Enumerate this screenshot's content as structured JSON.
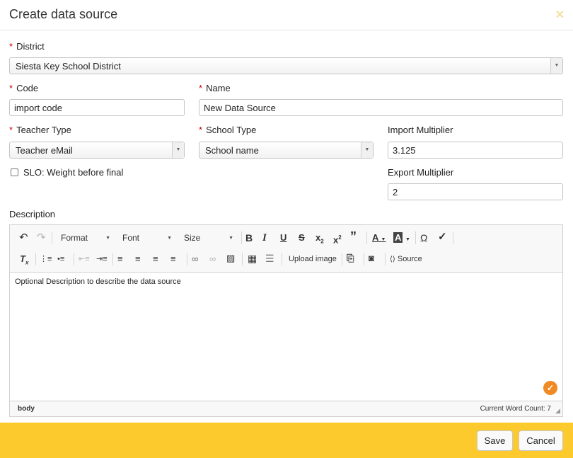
{
  "dialog": {
    "title": "Create data source",
    "close_glyph": "✕"
  },
  "form": {
    "district": {
      "label": "District",
      "value": "Siesta Key School District"
    },
    "code": {
      "label": "Code",
      "value": "import code"
    },
    "name": {
      "label": "Name",
      "value": "New Data Source"
    },
    "teacher_type": {
      "label": "Teacher Type",
      "value": "Teacher eMail"
    },
    "school_type": {
      "label": "School Type",
      "value": "School name"
    },
    "import_multiplier": {
      "label": "Import Multiplier",
      "value": "3.125"
    },
    "export_multiplier": {
      "label": "Export Multiplier",
      "value": "2"
    },
    "slo_checkbox": {
      "label": "SLO: Weight before final",
      "checked": false
    },
    "description_label": "Description",
    "required_mark": "*"
  },
  "editor": {
    "toolbar": {
      "format": "Format",
      "font": "Font",
      "size": "Size",
      "upload_image": "Upload image",
      "source": "Source"
    },
    "content": "Optional Description to describe the data source",
    "status_path": "body",
    "word_count": "Current Word Count: 7"
  },
  "footer": {
    "save_label": "Save",
    "cancel_label": "Cancel"
  },
  "colors": {
    "footer_bg": "#fcca2d",
    "required": "#cc0000",
    "spellcheck": "#f08a24"
  }
}
